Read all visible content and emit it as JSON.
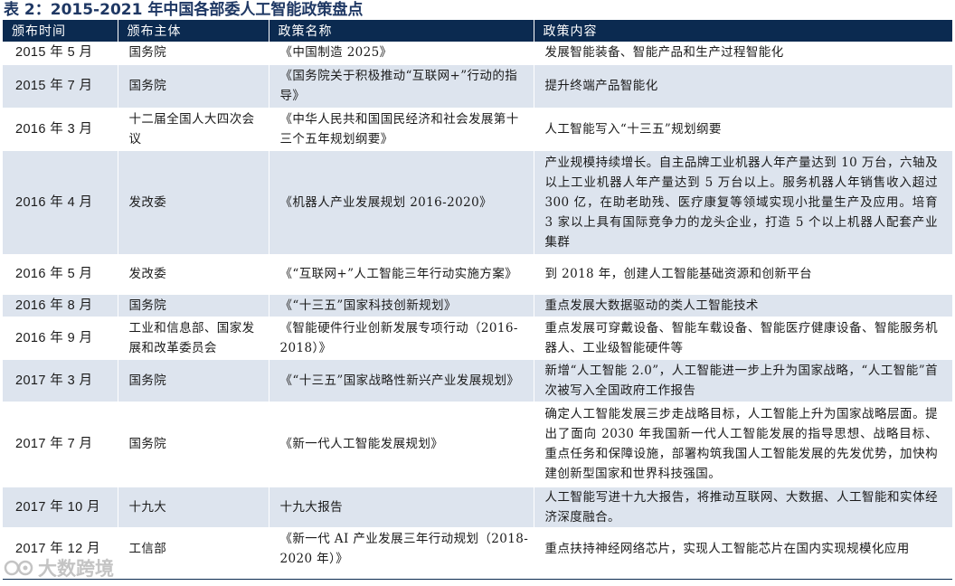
{
  "title": "表 2：2015-2021 年中国各部委人工智能政策盘点",
  "columns": [
    "颁布时间",
    "颁布主体",
    "政策名称",
    "政策内容"
  ],
  "rows": [
    {
      "date": "2015 年 5 月",
      "issuer": "国务院",
      "name": "《中国制造 2025》",
      "content": "发展智能装备、智能产品和生产过程智能化"
    },
    {
      "date": "2015 年 7 月",
      "issuer": "国务院",
      "name": "《国务院关于积极推动“互联网+”行动的指导》",
      "content": "提升终端产品智能化"
    },
    {
      "date": "2016 年 3 月",
      "issuer": "十二届全国人大四次会议",
      "name": "《中华人民共和国国民经济和社会发展第十三个五年规划纲要》",
      "content": "人工智能写入“十三五”规划纲要"
    },
    {
      "date": "2016 年 4 月",
      "issuer": "发改委",
      "name": "《机器人产业发展规划 2016-2020》",
      "content": "产业规模持续增长。自主品牌工业机器人年产量达到 10 万台，六轴及以上工业机器人年产量达到 5 万台以上。服务机器人年销售收入超过 300 亿，在助老助残、医疗康复等领域实现小批量生产及应用。培育 3 家以上具有国际竞争力的龙头企业，打造 5 个以上机器人配套产业集群"
    },
    {
      "date": "2016 年 5 月",
      "issuer": "发改委",
      "name": "《“互联网+”人工智能三年行动实施方案》",
      "content": "到 2018 年，创建人工智能基础资源和创新平台"
    },
    {
      "date": "2016 年 8 月",
      "issuer": "国务院",
      "name": "《“十三五”国家科技创新规划》",
      "content": "重点发展大数据驱动的类人工智能技术"
    },
    {
      "date": "2016 年 9 月",
      "issuer": "工业和信息部、国家发展和改革委员会",
      "name": "《智能硬件行业创新发展专项行动（2016-2018）》",
      "content": "重点发展可穿戴设备、智能车载设备、智能医疗健康设备、智能服务机器人、工业级智能硬件等"
    },
    {
      "date": "2017 年 3 月",
      "issuer": "国务院",
      "name": "《“十三五”国家战略性新兴产业发展规划》",
      "content": "新增“人工智能 2.0”，人工智能进一步上升为国家战略，“人工智能”首次被写入全国政府工作报告"
    },
    {
      "date": "2017 年 7 月",
      "issuer": "国务院",
      "name": "《新一代人工智能发展规划》",
      "content": "确定人工智能发展三步走战略目标，人工智能上升为国家战略层面。提出了面向 2030 年我国新一代人工智能发展的指导思想、战略目标、重点任务和保障设施，部署构筑我国人工智能发展的先发优势，加快构建创新型国家和世界科技强国。"
    },
    {
      "date": "2017 年 10 月",
      "issuer": "十九大",
      "name": "十九大报告",
      "content": "人工智能写进十九大报告，将推动互联网、大数据、人工智能和实体经济深度融合。"
    },
    {
      "date": "2017 年 12 月",
      "issuer": "工信部",
      "name": "《新一代 AI 产业发展三年行动规划（2018-2020 年）》",
      "content": "重点扶持神经网络芯片，实现人工智能芯片在国内实现规模化应用"
    }
  ],
  "watermark": "大数跨境"
}
